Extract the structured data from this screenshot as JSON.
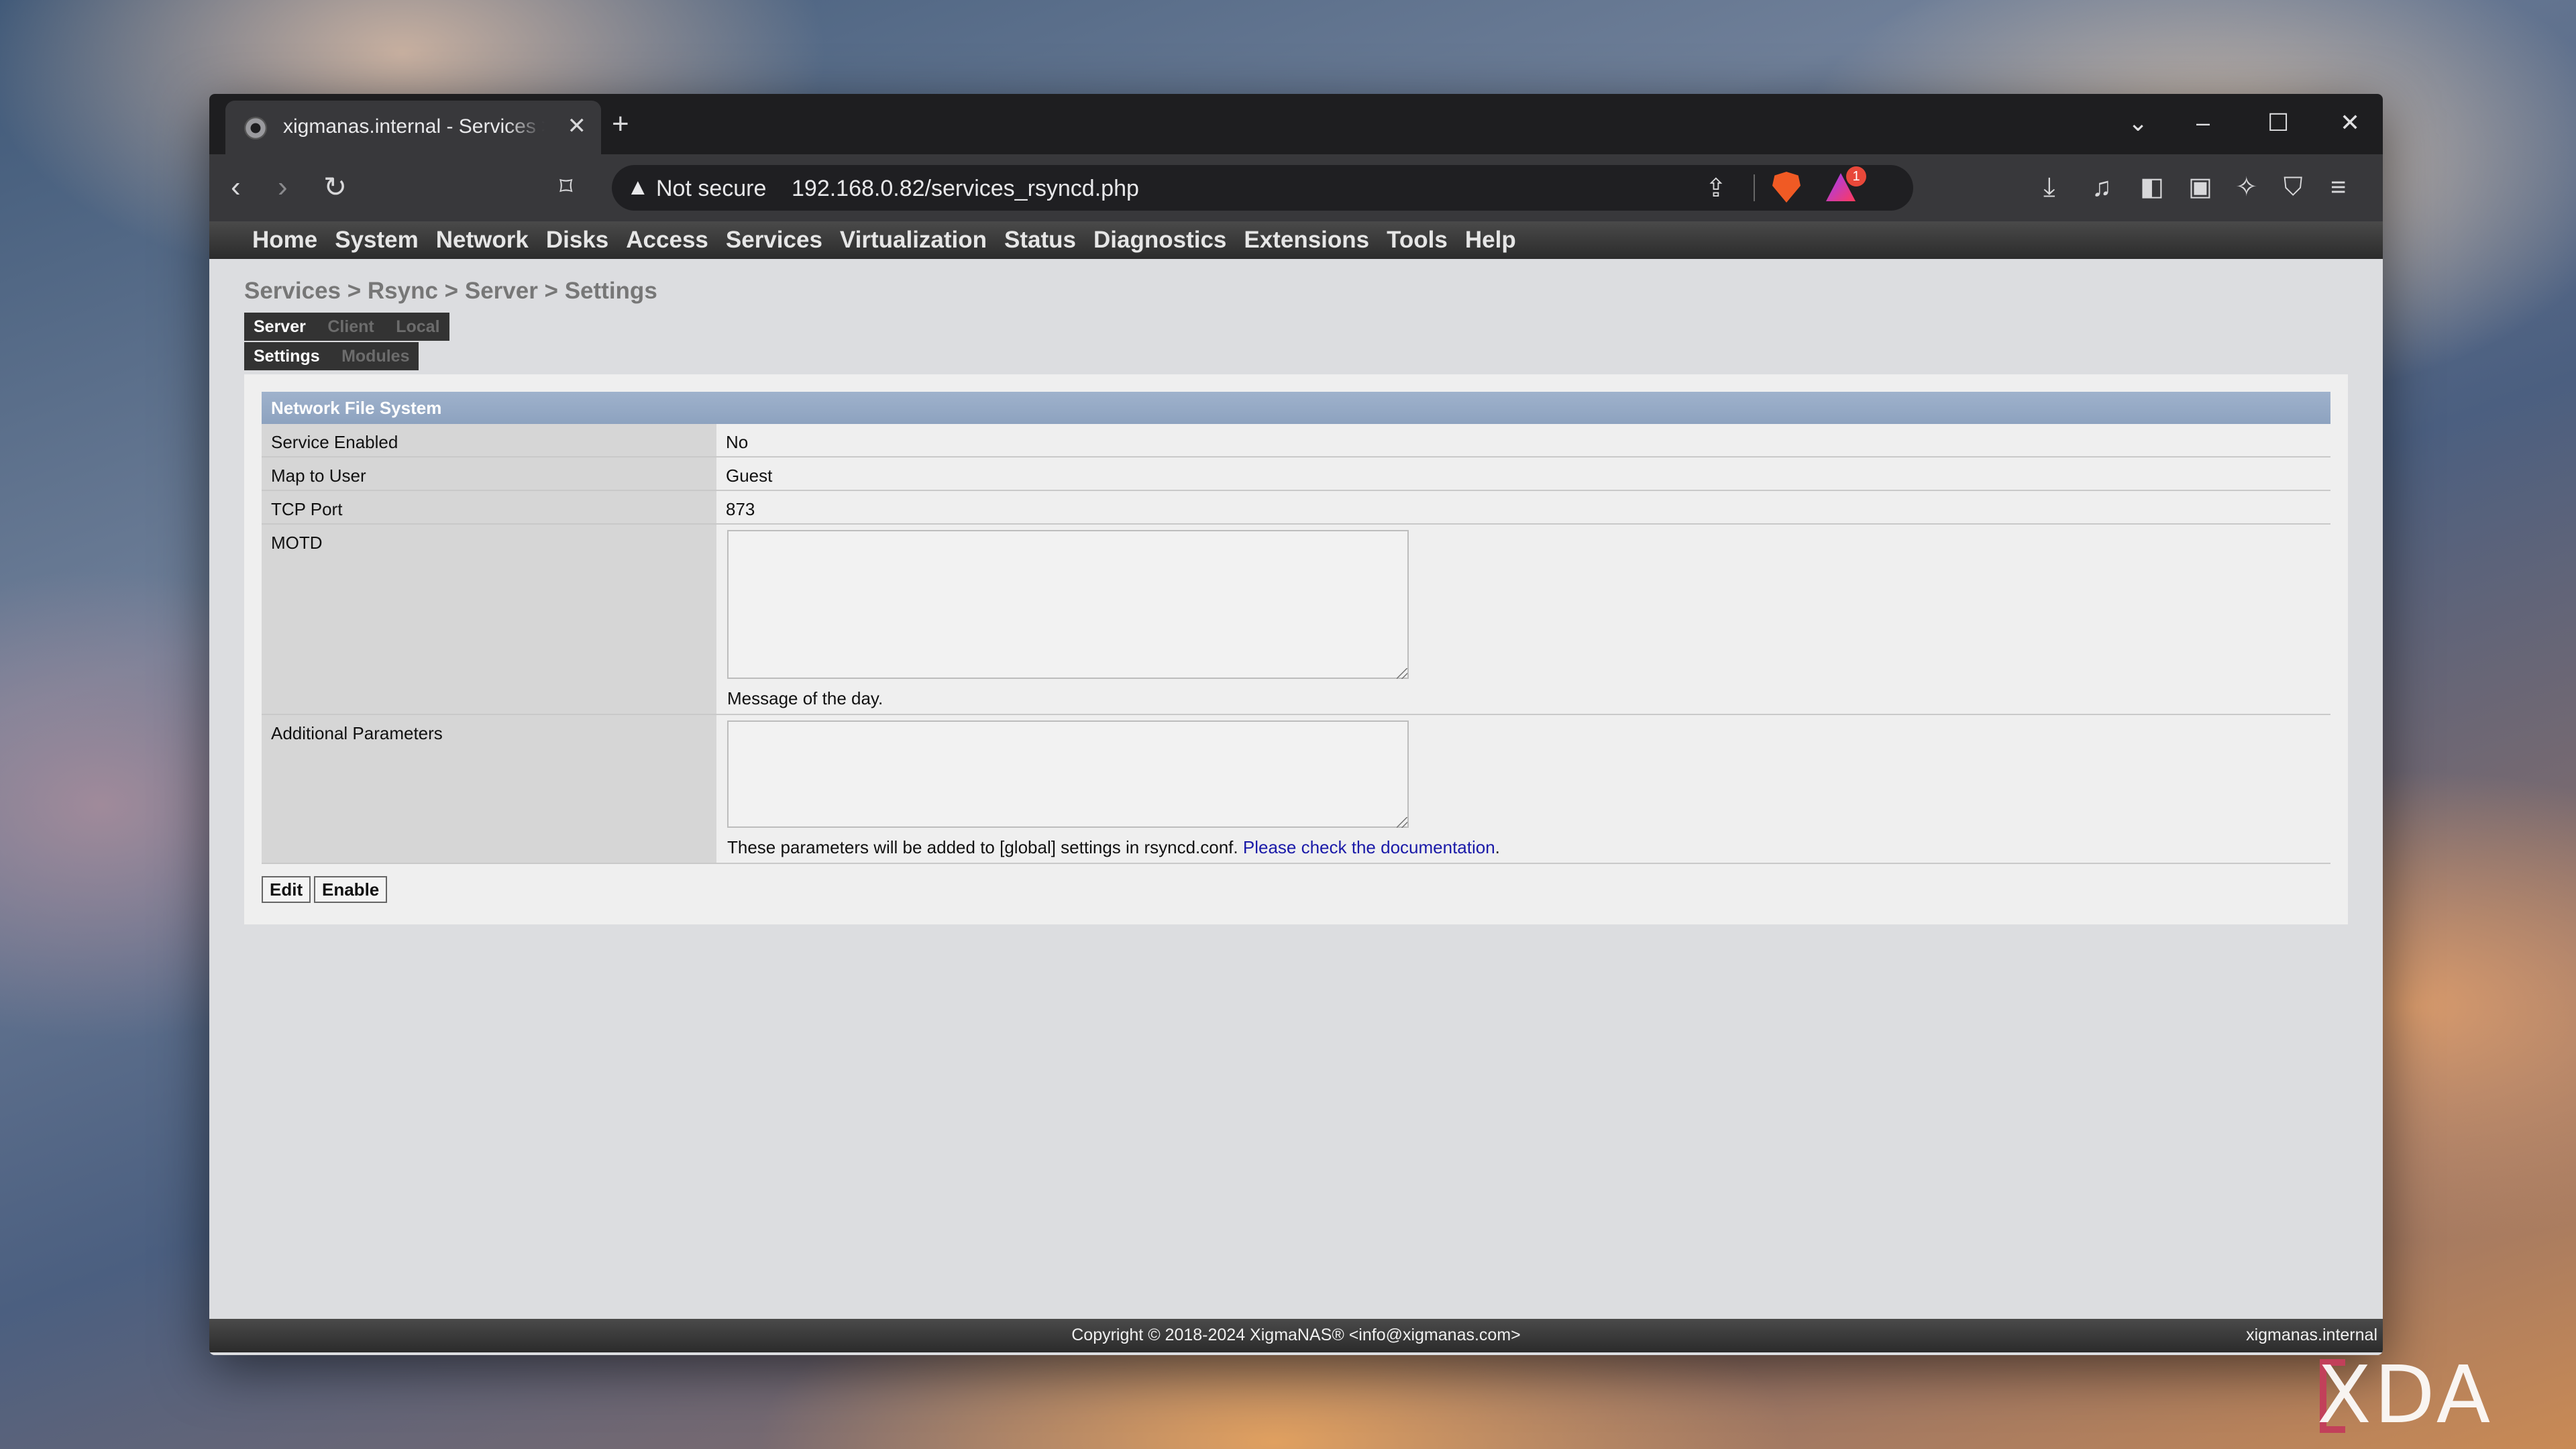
{
  "browser": {
    "tab_title": "xigmanas.internal - Services > Rsync > Server > Settings",
    "tab_close": "✕",
    "new_tab": "+",
    "window_controls": [
      "⌄",
      "–",
      "☐",
      "✕"
    ],
    "not_secure_label": "Not secure",
    "url": "192.168.0.82/services_rsyncd.php",
    "rewards_badge": "1",
    "icons": [
      "back-icon",
      "forward-icon",
      "reload-icon",
      "bookmark-icon",
      "share-icon",
      "brave-shields-icon",
      "brave-rewards-icon",
      "download-icon",
      "media-icon",
      "sidebar-icon",
      "wallet-icon",
      "leo-icon",
      "vpn-icon",
      "menu-icon"
    ]
  },
  "topnav": {
    "items": [
      "Home",
      "System",
      "Network",
      "Disks",
      "Access",
      "Services",
      "Virtualization",
      "Status",
      "Diagnostics",
      "Extensions",
      "Tools",
      "Help"
    ]
  },
  "breadcrumb": "Services > Rsync > Server > Settings",
  "tabs": {
    "row1": [
      {
        "label": "Server",
        "active": true
      },
      {
        "label": "Client",
        "active": false
      },
      {
        "label": "Local",
        "active": false
      }
    ],
    "row2": [
      {
        "label": "Settings",
        "active": true
      },
      {
        "label": "Modules",
        "active": false
      }
    ]
  },
  "form": {
    "section_title": "Network File System",
    "service_enabled": {
      "label": "Service Enabled",
      "value": "No"
    },
    "map_to_user": {
      "label": "Map to User",
      "value": "Guest"
    },
    "tcp_port": {
      "label": "TCP Port",
      "value": "873"
    },
    "motd": {
      "label": "MOTD",
      "value": "",
      "help": "Message of the day."
    },
    "aux_params": {
      "label": "Additional Parameters",
      "value": "",
      "help": "These parameters will be added to [global] settings in rsyncd.conf.",
      "help_link": "Please check the documentation",
      "help_end": "."
    }
  },
  "buttons": {
    "edit": "Edit",
    "enable": "Enable"
  },
  "footer": {
    "copyright": "Copyright © 2018-2024 XigmaNAS® <info@xigmanas.com>",
    "host": "xigmanas.internal"
  },
  "watermark": "XDA"
}
